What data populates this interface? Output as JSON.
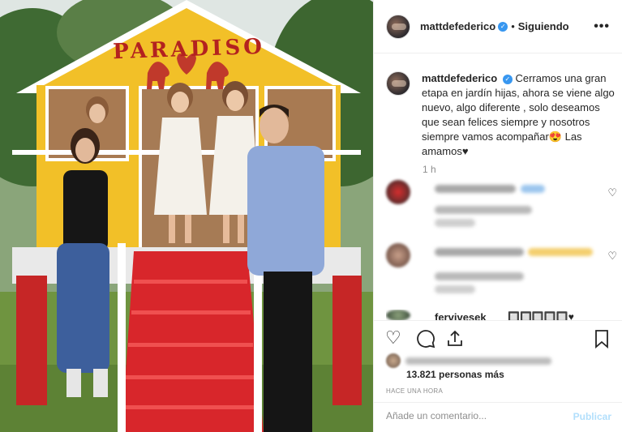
{
  "post": {
    "username": "mattdefederico",
    "follow_state": "Siguiendo",
    "more_options": "•••",
    "verified_mark": "✓"
  },
  "caption": {
    "username": "mattdefederico",
    "text": "Cerramos una gran etapa en jardín hijas, ahora se viene algo nuevo, algo diferente , solo deseamos que sean felices siempre y nosotros siempre vamos acompañar😍 Las amamos♥",
    "time": "1 h"
  },
  "comments": {
    "third_username": "fervivesek",
    "third_text": "🔲🔲🔲🔲🔲♥"
  },
  "actions": {
    "like_icon": "heart-outline",
    "comment_icon": "speech-bubble",
    "share_icon": "share-arrow",
    "save_icon": "bookmark"
  },
  "likes": {
    "others": "13.821 personas más"
  },
  "timestamp": "Hace una hora",
  "composer": {
    "placeholder": "Añade un comentario...",
    "publish_label": "Publicar"
  },
  "photo": {
    "sign": "PARADISO"
  },
  "colors": {
    "link_blue": "#3897f0",
    "publish_disabled": "#b2dffc",
    "house_yellow": "#f2c028",
    "stairs_red": "#d8262b"
  }
}
